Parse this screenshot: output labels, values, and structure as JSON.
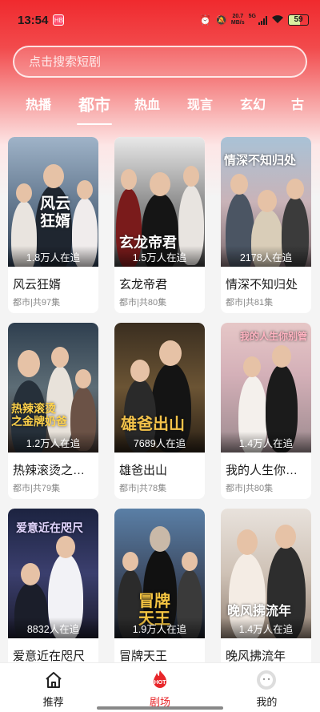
{
  "status_bar": {
    "time": "13:54",
    "app_badge": "HB",
    "net_speed_value": "20.7",
    "net_speed_unit": "MB/s",
    "signal_label": "5G",
    "battery": "59"
  },
  "search": {
    "placeholder": "点击搜索短剧"
  },
  "tabs": [
    {
      "label": "热播",
      "active": false
    },
    {
      "label": "都市",
      "active": true
    },
    {
      "label": "热血",
      "active": false
    },
    {
      "label": "现言",
      "active": false
    },
    {
      "label": "玄幻",
      "active": false
    },
    {
      "label": "古",
      "active": false
    }
  ],
  "dramas": [
    {
      "title": "风云狂婿",
      "meta": "都市|共97集",
      "followers": "1.8万人在追",
      "poster_text": "风云狂婿"
    },
    {
      "title": "玄龙帝君",
      "meta": "都市|共80集",
      "followers": "1.5万人在追",
      "poster_text": "玄龙帝君"
    },
    {
      "title": "情深不知归处",
      "meta": "都市|共81集",
      "followers": "2178人在追",
      "poster_text": "情深不知归处"
    },
    {
      "title": "热辣滚烫之…",
      "meta": "都市|共79集",
      "followers": "1.2万人在追",
      "poster_text": "热辣滚烫之金牌奶爸"
    },
    {
      "title": "雄爸出山",
      "meta": "都市|共78集",
      "followers": "7689人在追",
      "poster_text": "雄爸出山"
    },
    {
      "title": "我的人生你…",
      "meta": "都市|共80集",
      "followers": "1.4万人在追",
      "poster_text": "我的人生你别管"
    },
    {
      "title": "爱意近在咫尺",
      "meta": "",
      "followers": "8832人在追",
      "poster_text": "爱意近在咫尺"
    },
    {
      "title": "冒牌天王",
      "meta": "",
      "followers": "1.9万人在追",
      "poster_text": "冒牌天王"
    },
    {
      "title": "晚风拂流年",
      "meta": "",
      "followers": "1.4万人在追",
      "poster_text": "晚风拂流年"
    }
  ],
  "bottom_nav": [
    {
      "label": "推荐",
      "icon": "home-icon",
      "active": false
    },
    {
      "label": "剧场",
      "icon": "hot-icon",
      "active": true,
      "badge": "HOT"
    },
    {
      "label": "我的",
      "icon": "profile-icon",
      "active": false
    }
  ],
  "colors": {
    "accent": "#e8262a",
    "header_red": "#f02a2e"
  }
}
